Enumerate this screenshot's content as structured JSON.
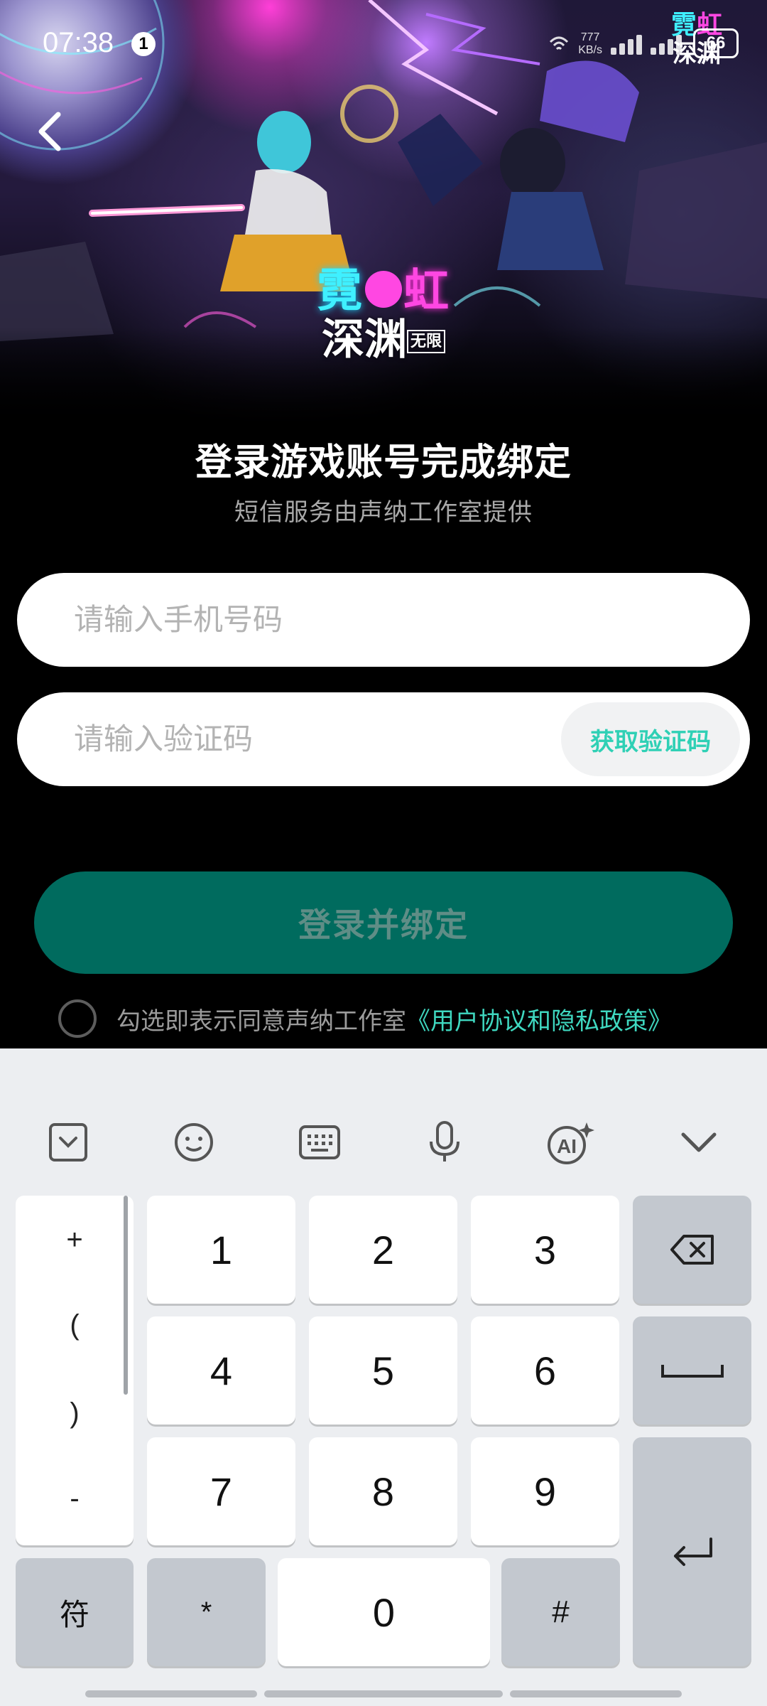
{
  "status_bar": {
    "time": "07:38",
    "notification_badge": "1",
    "net_speed_value": "777",
    "net_speed_unit": "KB/s",
    "battery": "66"
  },
  "hero": {
    "logo_line1_left": "霓",
    "logo_line1_right": "虹",
    "logo_line2": "深渊",
    "logo_tag": "无限"
  },
  "header": {
    "title": "登录游戏账号完成绑定",
    "subtitle": "短信服务由声纳工作室提供"
  },
  "form": {
    "phone_placeholder": "请输入手机号码",
    "code_placeholder": "请输入验证码",
    "get_code_label": "获取验证码",
    "login_label": "登录并绑定",
    "agree_text": "勾选即表示同意声纳工作室",
    "agree_link": "《用户协议和隐私政策》"
  },
  "keyboard": {
    "toolbar": [
      "collapse-icon",
      "emoji-icon",
      "keyboard-icon",
      "mic-icon",
      "ai-icon",
      "chevron-down-icon"
    ],
    "symbols": [
      "+",
      "(",
      ")",
      "-"
    ],
    "digits": [
      "1",
      "2",
      "3",
      "4",
      "5",
      "6",
      "7",
      "8",
      "9"
    ],
    "bottom": {
      "symbols_key": "符",
      "star": "*",
      "zero": "0",
      "hash": "#"
    }
  },
  "colors": {
    "accent": "#3fd8c0",
    "login_button": "#006b5e",
    "logo_cyan": "#3ff0ff",
    "logo_pink": "#ff47e2"
  }
}
